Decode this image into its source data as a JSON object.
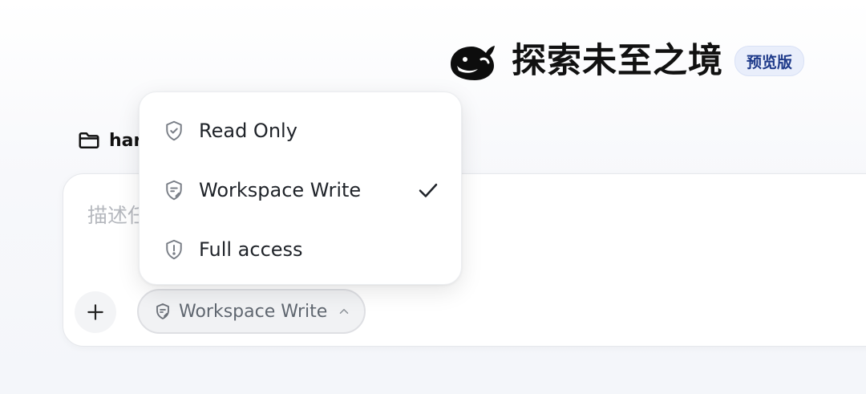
{
  "brand": {
    "logo_icon": "whale-logo-icon",
    "title": "探索未至之境",
    "badge": "预览版"
  },
  "folder": {
    "icon": "folder-icon",
    "name": "har"
  },
  "composer": {
    "placeholder": "描述任",
    "add_icon": "plus-icon",
    "mode_button": {
      "label": "Workspace Write",
      "icon": "shield-edit-icon",
      "chevron": "chevron-up-icon"
    }
  },
  "permission_menu": {
    "selected": "Workspace Write",
    "items": [
      {
        "label": "Read Only",
        "icon": "shield-check-icon"
      },
      {
        "label": "Workspace Write",
        "icon": "shield-edit-icon",
        "checked": true
      },
      {
        "label": "Full access",
        "icon": "shield-alert-icon"
      }
    ]
  },
  "colors": {
    "badge_bg": "#e9eefb",
    "badge_text": "#1e3a8a",
    "placeholder": "#b5b8be",
    "icon_gray": "#7a7f87"
  }
}
